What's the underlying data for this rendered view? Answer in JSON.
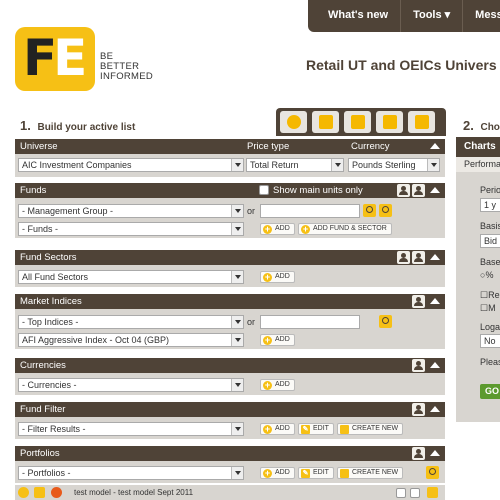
{
  "nav": {
    "whats_new": "What's new",
    "tools": "Tools",
    "messages": "Messa"
  },
  "logo": {
    "f": "F",
    "e": "E",
    "tagline_1": "BE",
    "tagline_2": "BETTER",
    "tagline_3": "INFORMED"
  },
  "page_title": "Retail UT and OEICs Univers",
  "step1": {
    "num": "1.",
    "label": "Build your active list"
  },
  "step2": {
    "num": "2.",
    "label": "Cho"
  },
  "universe": {
    "col_universe": "Universe",
    "col_price_type": "Price type",
    "col_currency": "Currency",
    "universe_value": "AIC Investment Companies",
    "price_type_value": "Total Return",
    "currency_value": "Pounds Sterling"
  },
  "funds": {
    "title": "Funds",
    "show_main_units": "Show main units only",
    "group_select": "- Management Group -",
    "funds_select": "- Funds -",
    "or": "or",
    "add": "ADD",
    "add_fund_sector": "ADD FUND & SECTOR"
  },
  "fund_sectors": {
    "title": "Fund Sectors",
    "select": "All Fund Sectors",
    "add": "ADD"
  },
  "market_indices": {
    "title": "Market Indices",
    "top_select": "- Top Indices -",
    "index_select": "AFI Aggressive Index - Oct 04 (GBP)",
    "or": "or",
    "add": "ADD"
  },
  "currencies": {
    "title": "Currencies",
    "select": "- Currencies -",
    "add": "ADD"
  },
  "fund_filter": {
    "title": "Fund Filter",
    "select": "- Filter Results -",
    "add": "ADD",
    "edit": "EDIT",
    "create_new": "CREATE NEW"
  },
  "portfolios": {
    "title": "Portfolios",
    "select": "- Portfolios -",
    "add": "ADD",
    "edit": "EDIT",
    "create_new": "CREATE NEW"
  },
  "bottom_row": {
    "label": "test model - test model Sept 2011"
  },
  "right_panel": {
    "tab": "Charts",
    "sub": "Performa",
    "period_label": "Perio",
    "period_value": "1 y",
    "basis_label": "Basis",
    "basis_value": "Bid",
    "base_label": "Base",
    "pct": "%",
    "r_label": "Re",
    "m_label": "M",
    "log_label": "Loga",
    "log_value": "No",
    "please": "Pleas",
    "go": "GO"
  }
}
